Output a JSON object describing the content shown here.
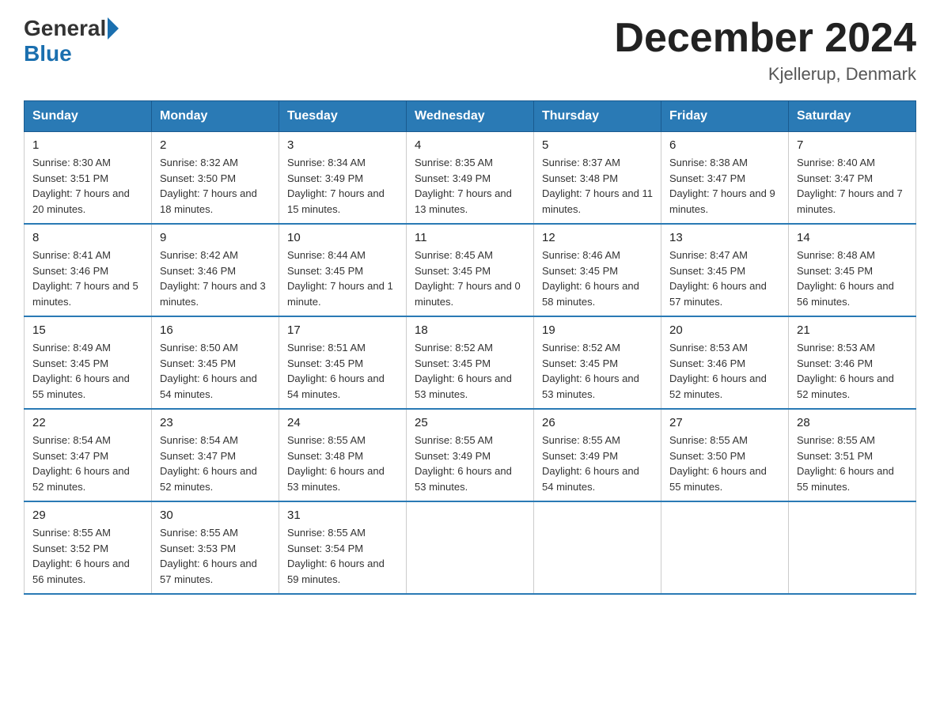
{
  "header": {
    "logo_general": "General",
    "logo_blue": "Blue",
    "month_title": "December 2024",
    "location": "Kjellerup, Denmark"
  },
  "weekdays": [
    "Sunday",
    "Monday",
    "Tuesday",
    "Wednesday",
    "Thursday",
    "Friday",
    "Saturday"
  ],
  "weeks": [
    [
      {
        "day": "1",
        "sunrise": "8:30 AM",
        "sunset": "3:51 PM",
        "daylight": "7 hours and 20 minutes."
      },
      {
        "day": "2",
        "sunrise": "8:32 AM",
        "sunset": "3:50 PM",
        "daylight": "7 hours and 18 minutes."
      },
      {
        "day": "3",
        "sunrise": "8:34 AM",
        "sunset": "3:49 PM",
        "daylight": "7 hours and 15 minutes."
      },
      {
        "day": "4",
        "sunrise": "8:35 AM",
        "sunset": "3:49 PM",
        "daylight": "7 hours and 13 minutes."
      },
      {
        "day": "5",
        "sunrise": "8:37 AM",
        "sunset": "3:48 PM",
        "daylight": "7 hours and 11 minutes."
      },
      {
        "day": "6",
        "sunrise": "8:38 AM",
        "sunset": "3:47 PM",
        "daylight": "7 hours and 9 minutes."
      },
      {
        "day": "7",
        "sunrise": "8:40 AM",
        "sunset": "3:47 PM",
        "daylight": "7 hours and 7 minutes."
      }
    ],
    [
      {
        "day": "8",
        "sunrise": "8:41 AM",
        "sunset": "3:46 PM",
        "daylight": "7 hours and 5 minutes."
      },
      {
        "day": "9",
        "sunrise": "8:42 AM",
        "sunset": "3:46 PM",
        "daylight": "7 hours and 3 minutes."
      },
      {
        "day": "10",
        "sunrise": "8:44 AM",
        "sunset": "3:45 PM",
        "daylight": "7 hours and 1 minute."
      },
      {
        "day": "11",
        "sunrise": "8:45 AM",
        "sunset": "3:45 PM",
        "daylight": "7 hours and 0 minutes."
      },
      {
        "day": "12",
        "sunrise": "8:46 AM",
        "sunset": "3:45 PM",
        "daylight": "6 hours and 58 minutes."
      },
      {
        "day": "13",
        "sunrise": "8:47 AM",
        "sunset": "3:45 PM",
        "daylight": "6 hours and 57 minutes."
      },
      {
        "day": "14",
        "sunrise": "8:48 AM",
        "sunset": "3:45 PM",
        "daylight": "6 hours and 56 minutes."
      }
    ],
    [
      {
        "day": "15",
        "sunrise": "8:49 AM",
        "sunset": "3:45 PM",
        "daylight": "6 hours and 55 minutes."
      },
      {
        "day": "16",
        "sunrise": "8:50 AM",
        "sunset": "3:45 PM",
        "daylight": "6 hours and 54 minutes."
      },
      {
        "day": "17",
        "sunrise": "8:51 AM",
        "sunset": "3:45 PM",
        "daylight": "6 hours and 54 minutes."
      },
      {
        "day": "18",
        "sunrise": "8:52 AM",
        "sunset": "3:45 PM",
        "daylight": "6 hours and 53 minutes."
      },
      {
        "day": "19",
        "sunrise": "8:52 AM",
        "sunset": "3:45 PM",
        "daylight": "6 hours and 53 minutes."
      },
      {
        "day": "20",
        "sunrise": "8:53 AM",
        "sunset": "3:46 PM",
        "daylight": "6 hours and 52 minutes."
      },
      {
        "day": "21",
        "sunrise": "8:53 AM",
        "sunset": "3:46 PM",
        "daylight": "6 hours and 52 minutes."
      }
    ],
    [
      {
        "day": "22",
        "sunrise": "8:54 AM",
        "sunset": "3:47 PM",
        "daylight": "6 hours and 52 minutes."
      },
      {
        "day": "23",
        "sunrise": "8:54 AM",
        "sunset": "3:47 PM",
        "daylight": "6 hours and 52 minutes."
      },
      {
        "day": "24",
        "sunrise": "8:55 AM",
        "sunset": "3:48 PM",
        "daylight": "6 hours and 53 minutes."
      },
      {
        "day": "25",
        "sunrise": "8:55 AM",
        "sunset": "3:49 PM",
        "daylight": "6 hours and 53 minutes."
      },
      {
        "day": "26",
        "sunrise": "8:55 AM",
        "sunset": "3:49 PM",
        "daylight": "6 hours and 54 minutes."
      },
      {
        "day": "27",
        "sunrise": "8:55 AM",
        "sunset": "3:50 PM",
        "daylight": "6 hours and 55 minutes."
      },
      {
        "day": "28",
        "sunrise": "8:55 AM",
        "sunset": "3:51 PM",
        "daylight": "6 hours and 55 minutes."
      }
    ],
    [
      {
        "day": "29",
        "sunrise": "8:55 AM",
        "sunset": "3:52 PM",
        "daylight": "6 hours and 56 minutes."
      },
      {
        "day": "30",
        "sunrise": "8:55 AM",
        "sunset": "3:53 PM",
        "daylight": "6 hours and 57 minutes."
      },
      {
        "day": "31",
        "sunrise": "8:55 AM",
        "sunset": "3:54 PM",
        "daylight": "6 hours and 59 minutes."
      },
      null,
      null,
      null,
      null
    ]
  ],
  "labels": {
    "sunrise": "Sunrise:",
    "sunset": "Sunset:",
    "daylight": "Daylight:"
  }
}
